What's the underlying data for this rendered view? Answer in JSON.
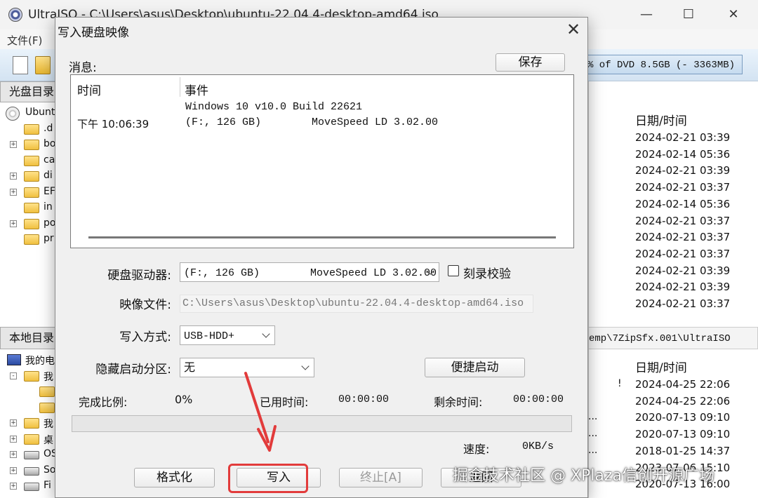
{
  "main_window": {
    "title": "UltraISO - C:\\Users\\asus\\Desktop\\ubuntu-22.04.4-desktop-amd64.iso",
    "menu_file": "文件(F)",
    "size_bar": "% of DVD 8.5GB (- 3363MB)",
    "cd_pane_header": "光盘目录:",
    "local_pane_header": "本地目录:",
    "local_path": "emp\\7ZipSfx.001\\UltraISO",
    "cd_tree": [
      {
        "label": "Ubuntu",
        "expander": "",
        "icon": "disc"
      },
      {
        "label": ".d",
        "expander": "",
        "icon": "folder"
      },
      {
        "label": "bo",
        "expander": "+",
        "icon": "folder"
      },
      {
        "label": "ca",
        "expander": "",
        "icon": "folder"
      },
      {
        "label": "di",
        "expander": "+",
        "icon": "folder"
      },
      {
        "label": "EF",
        "expander": "+",
        "icon": "folder"
      },
      {
        "label": "in",
        "expander": "",
        "icon": "folder"
      },
      {
        "label": "po",
        "expander": "+",
        "icon": "folder"
      },
      {
        "label": "pr",
        "expander": "",
        "icon": "folder"
      }
    ],
    "local_tree": [
      {
        "label": "我的电脑",
        "expander": "",
        "icon": "computer"
      },
      {
        "label": "我",
        "expander": "-",
        "icon": "folder"
      },
      {
        "label": "",
        "expander": "",
        "icon": "folder"
      },
      {
        "label": "",
        "expander": "",
        "icon": "folder"
      },
      {
        "label": "我",
        "expander": "+",
        "icon": "folder"
      },
      {
        "label": "桌",
        "expander": "+",
        "icon": "folder"
      },
      {
        "label": "OS",
        "expander": "+",
        "icon": "drive"
      },
      {
        "label": "So",
        "expander": "+",
        "icon": "drive"
      },
      {
        "label": "Fi",
        "expander": "+",
        "icon": "drive"
      }
    ],
    "cd_date_header": "日期/时间",
    "cd_dates": [
      "2024-02-21 03:39",
      "2024-02-14 05:36",
      "2024-02-21 03:39",
      "2024-02-21 03:37",
      "2024-02-14 05:36",
      "2024-02-21 03:37",
      "2024-02-21 03:37",
      "2024-02-21 03:37",
      "2024-02-21 03:39",
      "2024-02-21 03:39",
      "2024-02-21 03:37"
    ],
    "local_date_header": "日期/时间",
    "local_marks": [
      "!",
      "",
      "...",
      "...",
      "...",
      ""
    ],
    "local_dates": [
      "2024-04-25 22:06",
      "2024-04-25 22:06",
      "2020-07-13 09:10",
      "2020-07-13 09:10",
      "2018-01-25 14:37",
      "2023-07-06 15:10",
      "2020-07-13 16:00"
    ]
  },
  "dialog": {
    "title": "写入硬盘映像",
    "close_glyph": "✕",
    "msg_label": "消息:",
    "save_button": "保存",
    "log": {
      "col_time": "时间",
      "col_event": "事件",
      "rows": [
        {
          "time": "",
          "event": "Windows 10 v10.0 Build 22621"
        },
        {
          "time": "下午 10:06:39",
          "event": "(F:, 126 GB)        MoveSpeed LD 3.02.00"
        }
      ]
    },
    "disk_drive_label": "硬盘驱动器:",
    "disk_drive_value": "(F:, 126 GB)        MoveSpeed LD 3.02.00",
    "verify_label": "刻录校验",
    "image_file_label": "映像文件:",
    "image_file_value": "C:\\Users\\asus\\Desktop\\ubuntu-22.04.4-desktop-amd64.iso",
    "write_method_label": "写入方式:",
    "write_method_value": "USB-HDD+",
    "hidden_partition_label": "隐藏启动分区:",
    "hidden_partition_value": "无",
    "quick_boot_button": "便捷启动",
    "progress_label": "完成比例:",
    "progress_value": "0%",
    "progress_fraction": 0,
    "elapsed_label": "已用时间:",
    "elapsed_value": "00:00:00",
    "remaining_label": "剩余时间:",
    "remaining_value": "00:00:00",
    "speed_label": "速度:",
    "speed_value": "0KB/s",
    "format_button": "格式化",
    "write_button": "写入",
    "stop_button": "终止[A]",
    "back_button": "返回"
  },
  "watermark": "掘金技术社区 @ XPlaza信创开源广场",
  "colors": {
    "highlight": "#e23b3b",
    "progress_fill": "#06b025"
  }
}
